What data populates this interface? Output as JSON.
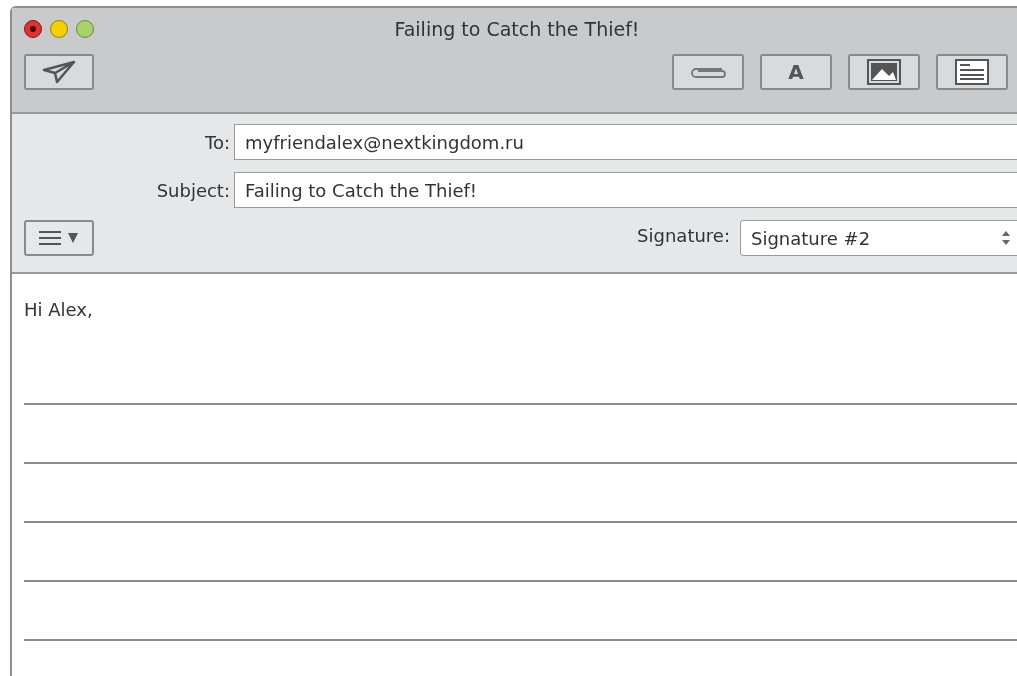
{
  "window": {
    "title": "Failing to Catch the Thief!"
  },
  "toolbar": {
    "format_button": "A"
  },
  "fields": [
    {
      "label": "To:",
      "value": "myfriendalex@nextkingdom.ru"
    },
    {
      "label": "Subject:",
      "value": "Failing to Catch the Thief!"
    }
  ],
  "signature": {
    "label": "Signature:",
    "value": "Signature #2"
  },
  "body": {
    "greeting": "Hi Alex,",
    "lines": [
      {
        "kind": "blank"
      },
      {
        "kind": "blank"
      },
      {
        "kind": "blank"
      },
      {
        "kind": "blank"
      },
      {
        "kind": "blank"
      }
    ]
  }
}
